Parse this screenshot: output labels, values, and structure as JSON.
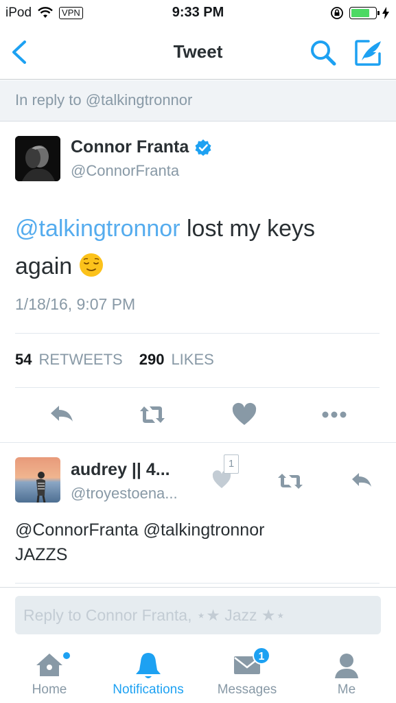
{
  "status_bar": {
    "carrier": "iPod",
    "vpn": "VPN",
    "time": "9:33 PM",
    "battery_level": 0.75
  },
  "nav": {
    "title": "Tweet",
    "icons": [
      "back-chevron-icon",
      "search-icon",
      "compose-icon"
    ]
  },
  "reply_banner": {
    "text": "In reply to @talkingtronnor"
  },
  "tweet": {
    "author_name": "Connor Franta",
    "verified": true,
    "author_handle": "@ConnorFranta",
    "mention": "@talkingtronnor",
    "text": " lost my keys again ",
    "emoji": "relieved-face",
    "timestamp": "1/18/16, 9:07 PM",
    "retweet_count": "54",
    "retweet_label": "RETWEETS",
    "like_count": "290",
    "like_label": "LIKES"
  },
  "reply": {
    "author_name": "audrey || 4...",
    "author_handle": "@troyestoena...",
    "text_line1": "@ConnorFranta @talkingtronnor",
    "text_line2": "JAZZS",
    "like_count": "1"
  },
  "composer": {
    "placeholder": "Reply to Connor Franta, ⋆★ Jazz ★⋆"
  },
  "tabs": [
    {
      "label": "Home",
      "icon": "home-icon",
      "active": false
    },
    {
      "label": "Notifications",
      "icon": "bell-icon",
      "active": true
    },
    {
      "label": "Messages",
      "icon": "envelope-icon",
      "active": false,
      "badge": "1"
    },
    {
      "label": "Me",
      "icon": "person-icon",
      "active": false
    }
  ],
  "colors": {
    "accent": "#1da1f2",
    "link": "#55acee",
    "muted": "#8899a6",
    "icon_gray": "#8899a6"
  }
}
